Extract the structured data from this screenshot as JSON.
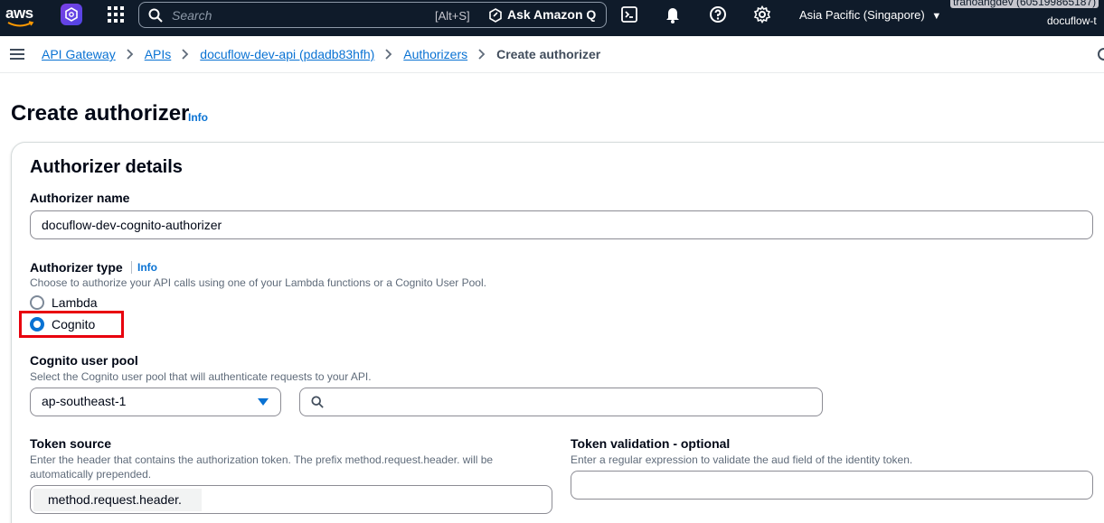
{
  "nav": {
    "logo_text": "aws",
    "search_placeholder": "Search",
    "search_shortcut": "[Alt+S]",
    "ask_q_label": "Ask Amazon Q",
    "region": "Asia Pacific (Singapore)",
    "account_line1": "tranoangdev (605199865187)",
    "account_line2": "docuflow-t"
  },
  "breadcrumb": {
    "items": [
      "API Gateway",
      "APIs",
      "docuflow-dev-api (pdadb83hfh)",
      "Authorizers"
    ],
    "current": "Create authorizer"
  },
  "page": {
    "title": "Create authorizer",
    "info": "Info"
  },
  "panel": {
    "title": "Authorizer details",
    "name_label": "Authorizer name",
    "name_value": "docuflow-dev-cognito-authorizer",
    "type_label": "Authorizer type",
    "type_info": "Info",
    "type_desc": "Choose to authorize your API calls using one of your Lambda functions or a Cognito User Pool.",
    "option_lambda": "Lambda",
    "option_cognito": "Cognito",
    "selected_type": "Cognito",
    "pool_label": "Cognito user pool",
    "pool_desc": "Select the Cognito user pool that will authenticate requests to your API.",
    "region_value": "ap-southeast-1",
    "pool_search_value": "",
    "token_source_label": "Token source",
    "token_source_desc_1": "Enter the header that contains the authorization token. The prefix method.request.header. will be",
    "token_source_desc_2": "automatically prepended.",
    "token_source_prefix": "method.request.header.",
    "token_validation_label": "Token validation - optional",
    "token_validation_desc": "Enter a regular expression to validate the aud field of the identity token.",
    "token_validation_value": ""
  },
  "colors": {
    "nav_bg": "#0f1b2a",
    "link": "#0972d3",
    "highlight": "#e8000d"
  }
}
